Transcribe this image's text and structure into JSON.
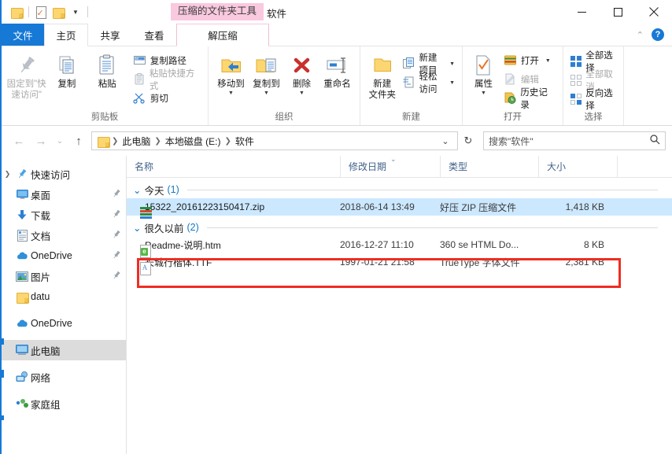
{
  "window": {
    "title": "软件",
    "contextual_tab_header": "压缩的文件夹工具",
    "minimize_label": "最小化",
    "maximize_label": "最大化",
    "close_label": "关闭",
    "quick_access": [
      {
        "name": "folder-icon",
        "label": "新建文件夹"
      },
      {
        "name": "properties-icon",
        "label": "属性"
      },
      {
        "name": "folder-icon",
        "label": "新建文件夹"
      }
    ],
    "qat_dropdown": "▼"
  },
  "ribbon": {
    "tabs": [
      {
        "label": "文件",
        "kind": "file"
      },
      {
        "label": "主页",
        "kind": "active"
      },
      {
        "label": "共享",
        "kind": "normal"
      },
      {
        "label": "查看",
        "kind": "normal"
      },
      {
        "label": "解压缩",
        "kind": "contextual"
      }
    ],
    "collapse_caret": "⌃",
    "help_label": "?",
    "groups": [
      {
        "label": "剪贴板",
        "big_buttons": [
          {
            "label": "固定到\"快\n速访问\"",
            "icon": "pin-icon",
            "dim": true
          },
          {
            "label": "复制",
            "icon": "copy-icon",
            "dim": false
          },
          {
            "label": "粘贴",
            "icon": "paste-icon",
            "dim": false
          }
        ],
        "small_buttons": [
          {
            "label": "复制路径",
            "icon": "copy-path-icon",
            "dim": false
          },
          {
            "label": "粘贴快捷方式",
            "icon": "paste-shortcut-icon",
            "dim": true
          },
          {
            "label": "剪切",
            "icon": "scissors-icon",
            "dim": false
          }
        ]
      },
      {
        "label": "组织",
        "big_buttons": [
          {
            "label": "移动到",
            "icon": "move-to-icon",
            "caret": true
          },
          {
            "label": "复制到",
            "icon": "copy-to-icon",
            "caret": true
          },
          {
            "label": "删除",
            "icon": "delete-icon",
            "caret": true
          },
          {
            "label": "重命名",
            "icon": "rename-icon",
            "caret": false
          }
        ]
      },
      {
        "label": "新建",
        "big_buttons": [
          {
            "label": "新建\n文件夹",
            "icon": "new-folder-icon"
          }
        ],
        "small_buttons": [
          {
            "label": "新建项目",
            "icon": "new-item-icon",
            "caret": true
          },
          {
            "label": "轻松访问",
            "icon": "easy-access-icon",
            "caret": true
          }
        ]
      },
      {
        "label": "打开",
        "big_buttons": [
          {
            "label": "属性",
            "icon": "properties-icon",
            "caret": true
          }
        ],
        "small_buttons": [
          {
            "label": "打开",
            "icon": "open-icon",
            "caret": true
          },
          {
            "label": "编辑",
            "icon": "edit-icon",
            "dim": true
          },
          {
            "label": "历史记录",
            "icon": "history-icon"
          }
        ]
      },
      {
        "label": "选择",
        "small_buttons": [
          {
            "label": "全部选择",
            "icon": "select-all-icon"
          },
          {
            "label": "全部取消",
            "icon": "select-none-icon",
            "dim": true
          },
          {
            "label": "反向选择",
            "icon": "invert-selection-icon"
          }
        ]
      }
    ]
  },
  "addressbar": {
    "back_label": "←",
    "forward_label": "→",
    "recent_label": "⌄",
    "up_label": "↑",
    "breadcrumbs": [
      "此电脑",
      "本地磁盘 (E:)",
      "软件"
    ],
    "separator": "❯",
    "dropdown_label": "⌄",
    "refresh_label": "↻",
    "search_placeholder": "搜索\"软件\"",
    "search_value": "",
    "search_icon": "search-icon"
  },
  "navpane": {
    "items": [
      {
        "label": "快速访问",
        "icon": "pin-icon",
        "chevron": true,
        "indent": 0,
        "pinned": false,
        "selected": false
      },
      {
        "label": "桌面",
        "icon": "desktop-icon",
        "chevron": false,
        "indent": 1,
        "pinned": true,
        "selected": false
      },
      {
        "label": "下载",
        "icon": "downloads-icon",
        "chevron": false,
        "indent": 1,
        "pinned": true,
        "selected": false
      },
      {
        "label": "文档",
        "icon": "documents-icon",
        "chevron": false,
        "indent": 1,
        "pinned": true,
        "selected": false
      },
      {
        "label": "OneDrive",
        "icon": "onedrive-icon",
        "chevron": false,
        "indent": 1,
        "pinned": true,
        "selected": false
      },
      {
        "label": "图片",
        "icon": "pictures-icon",
        "chevron": false,
        "indent": 1,
        "pinned": true,
        "selected": false
      },
      {
        "label": "datu",
        "icon": "folder-icon",
        "chevron": false,
        "indent": 1,
        "pinned": false,
        "selected": false
      },
      {
        "label": "OneDrive",
        "icon": "onedrive-icon",
        "chevron": false,
        "indent": 0,
        "pinned": false,
        "selected": false,
        "gap_before": true
      },
      {
        "label": "此电脑",
        "icon": "this-pc-icon",
        "chevron": false,
        "indent": 0,
        "pinned": false,
        "selected": true,
        "gap_before": true
      },
      {
        "label": "网络",
        "icon": "network-icon",
        "chevron": false,
        "indent": 0,
        "pinned": false,
        "selected": false,
        "gap_before": true
      },
      {
        "label": "家庭组",
        "icon": "homegroup-icon",
        "chevron": false,
        "indent": 0,
        "pinned": false,
        "selected": false,
        "gap_before": true
      }
    ]
  },
  "filelist": {
    "columns": [
      {
        "label": "名称",
        "sorted": false
      },
      {
        "label": "修改日期",
        "sorted": true
      },
      {
        "label": "类型",
        "sorted": false
      },
      {
        "label": "大小",
        "sorted": false
      }
    ],
    "sort_indicator": "⌄",
    "groups": [
      {
        "name": "今天",
        "count": "(1)",
        "chevron": "⌄",
        "rows": [
          {
            "name": "15322_20161223150417.zip",
            "date": "2018-06-14 13:49",
            "type": "好压 ZIP 压缩文件",
            "size": "1,418 KB",
            "icon": "zip-file-icon",
            "selected": true
          }
        ]
      },
      {
        "name": "很久以前",
        "count": "(2)",
        "chevron": "⌄",
        "rows": [
          {
            "name": "Readme-说明.htm",
            "date": "2016-12-27 11:10",
            "type": "360 se HTML Do...",
            "size": "8 KB",
            "icon": "html-file-icon",
            "selected": false
          },
          {
            "name": "长城行楷体.TTF",
            "date": "1997-01-21 21:58",
            "type": "TrueType 字体文件",
            "size": "2,381 KB",
            "icon": "ttf-file-icon",
            "selected": false
          }
        ]
      }
    ]
  },
  "annotation": {
    "type": "red-rectangle-highlight",
    "target": "长城行楷体.TTF"
  },
  "colors": {
    "accent": "#1779d6",
    "selection": "#cce8ff",
    "contextual_tab": "#f9c9df",
    "annotation": "#ef2d23",
    "group_header": "#1479c4"
  }
}
